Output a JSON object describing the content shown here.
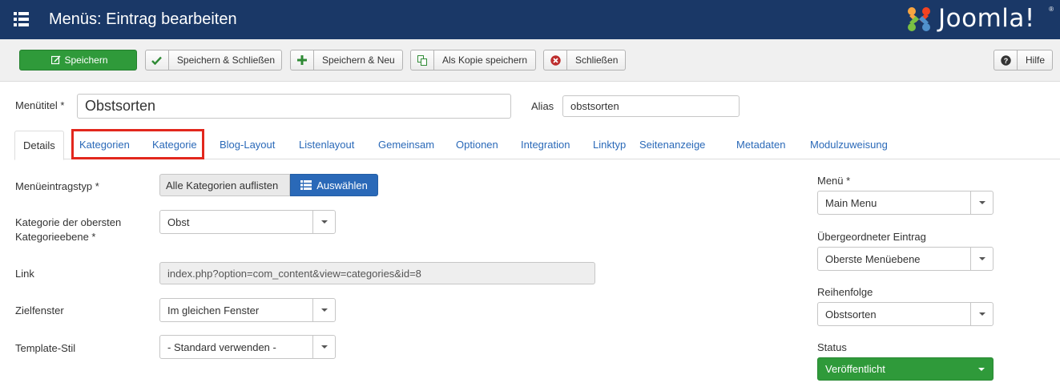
{
  "header": {
    "title": "Menüs: Eintrag bearbeiten",
    "logo_text": "Joomla!",
    "logo_reg": "®",
    "brand_color": "#1a3867"
  },
  "toolbar": {
    "save_label": "Speichern",
    "save_close_label": "Speichern & Schließen",
    "save_new_label": "Speichern & Neu",
    "save_copy_label": "Als Kopie speichern",
    "close_label": "Schließen",
    "help_label": "Hilfe"
  },
  "form": {
    "menu_title_label": "Menütitel *",
    "menu_title_value": "Obstsorten",
    "alias_label": "Alias",
    "alias_value": "obstsorten"
  },
  "tabs": [
    {
      "label": "Details"
    },
    {
      "label": "Kategorien"
    },
    {
      "label": "Kategorie"
    },
    {
      "label": "Blog-Layout"
    },
    {
      "label": "Listenlayout"
    },
    {
      "label": "Gemeinsam"
    },
    {
      "label": "Optionen"
    },
    {
      "label": "Integration"
    },
    {
      "label": "Linktyp"
    },
    {
      "label": "Seitenanzeige"
    },
    {
      "label": "Metadaten"
    },
    {
      "label": "Modulzuweisung"
    }
  ],
  "details": {
    "item_type_label": "Menüeintragstyp *",
    "item_type_value": "Alle Kategorien auflisten",
    "select_button_label": "Auswählen",
    "top_category_label_line1": "Kategorie der obersten",
    "top_category_label_line2": "Kategorieebene *",
    "top_category_value": "Obst",
    "link_label": "Link",
    "link_value": "index.php?option=com_content&view=categories&id=8",
    "target_label": "Zielfenster",
    "target_value": "Im gleichen Fenster",
    "template_label": "Template-Stil",
    "template_value": "- Standard verwenden -"
  },
  "sidebar": {
    "menu_label": "Menü *",
    "menu_value": "Main Menu",
    "parent_label": "Übergeordneter Eintrag",
    "parent_value": "Oberste Menüebene",
    "order_label": "Reihenfolge",
    "order_value": "Obstsorten",
    "status_label": "Status",
    "status_value": "Veröffentlicht",
    "status_color": "#2f9a3a"
  },
  "accent": {
    "link_color": "#2a69b8",
    "highlight_color": "#e2271d"
  }
}
